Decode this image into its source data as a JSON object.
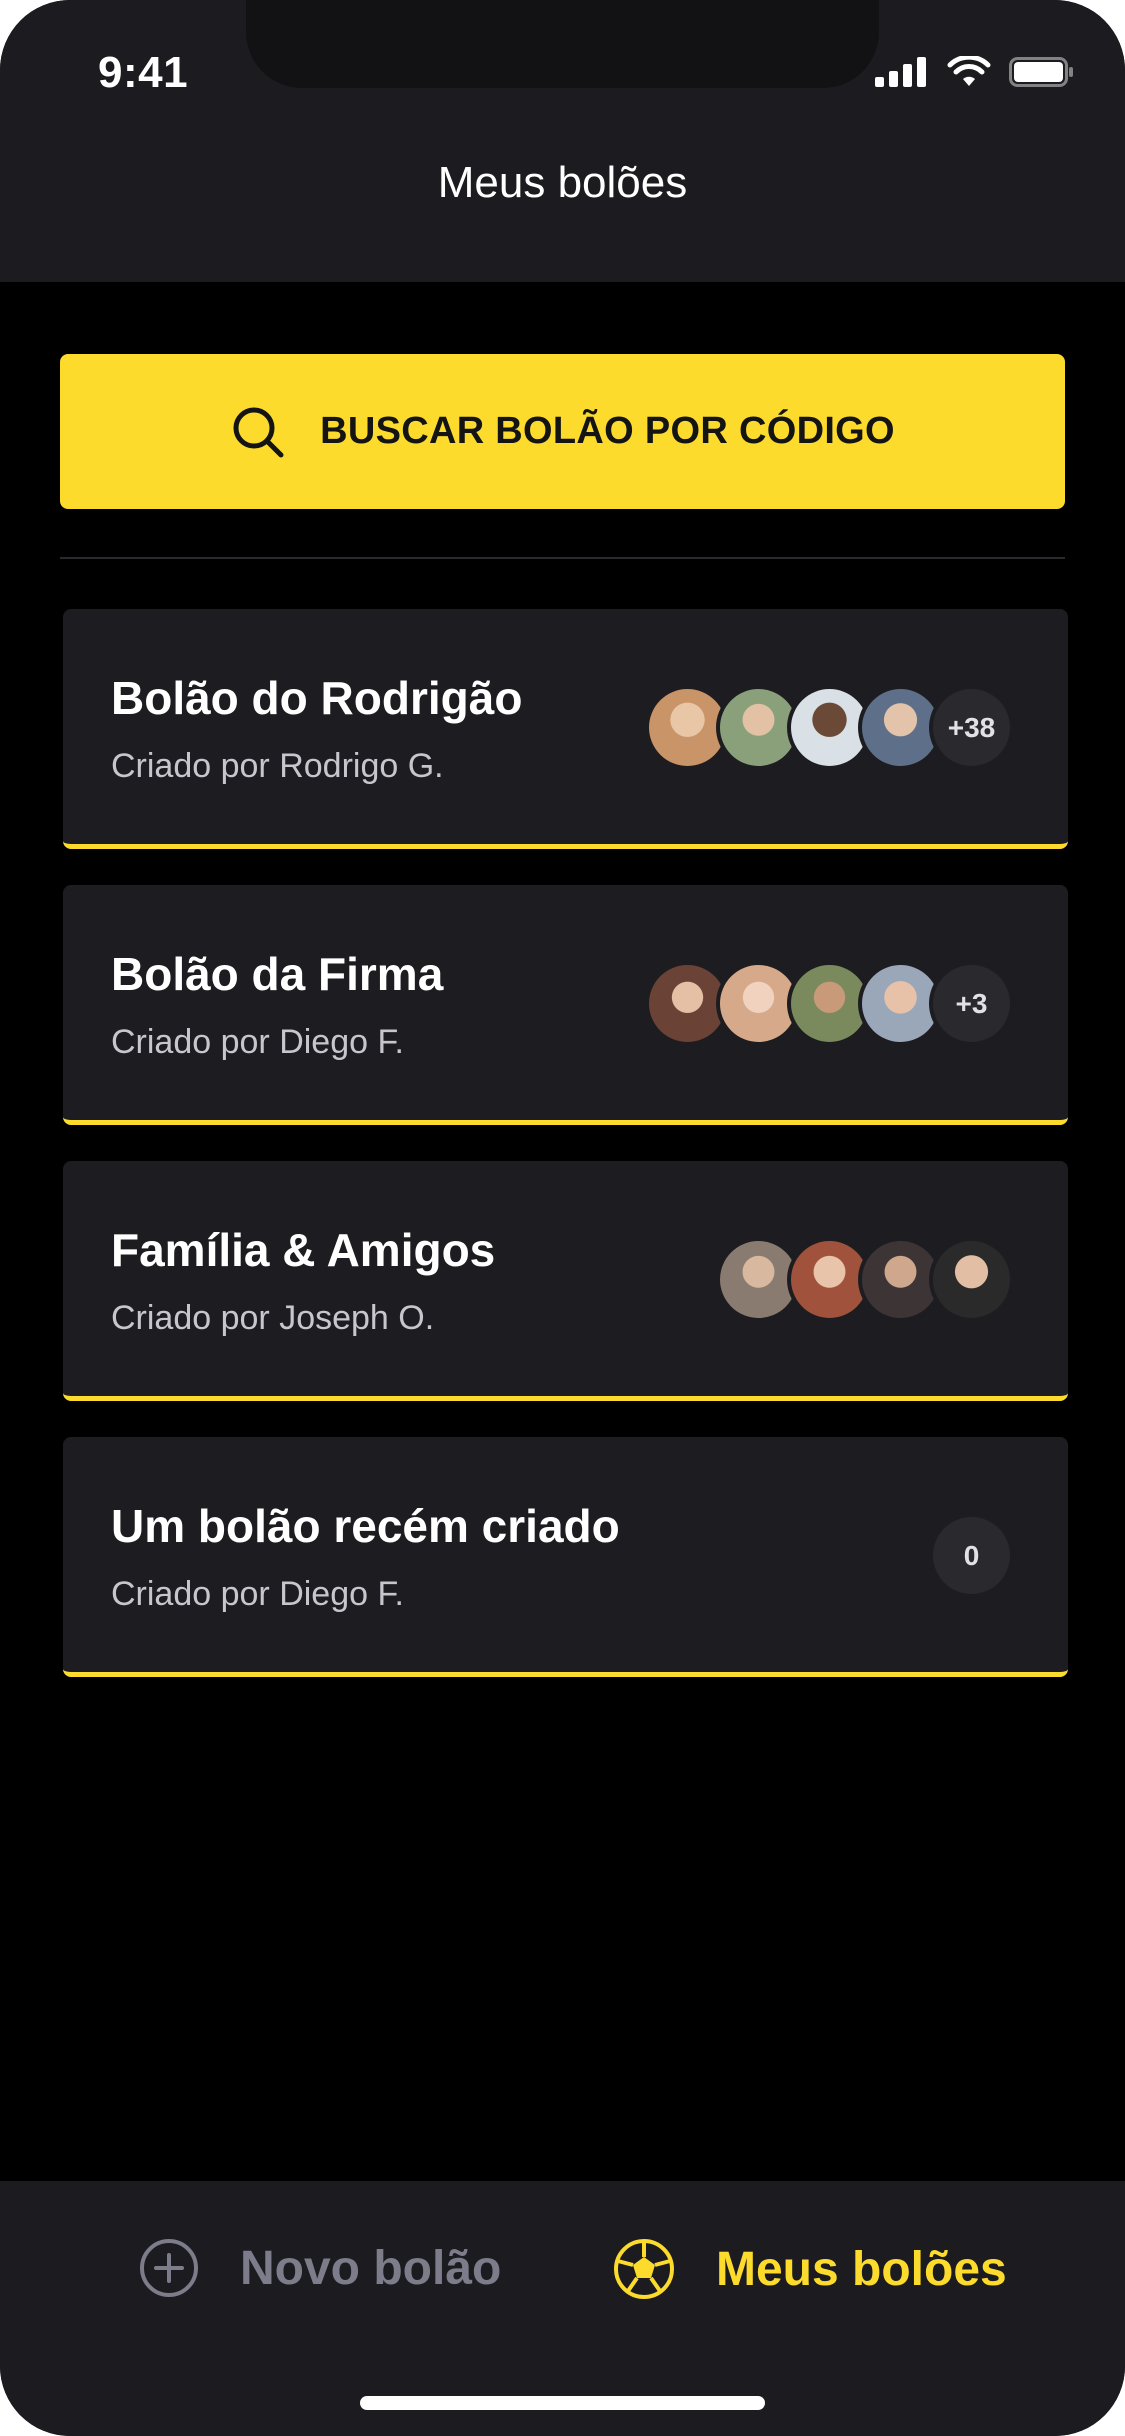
{
  "status_bar": {
    "time": "9:41"
  },
  "header": {
    "title": "Meus bolões"
  },
  "search": {
    "label": "BUSCAR BOLÃO POR CÓDIGO",
    "icon": "search-icon"
  },
  "pools": [
    {
      "title": "Bolão do Rodrigão",
      "creator": "Criado por Rodrigo G.",
      "extra_count": "+38",
      "avatar_colors": [
        "#c99468",
        "#8aa07a",
        "#4c3a2e",
        "#5e6f8a"
      ]
    },
    {
      "title": "Bolão da Firma",
      "creator": "Criado por Diego F.",
      "extra_count": "+3",
      "avatar_colors": [
        "#6b4336",
        "#d6a98a",
        "#7a8a5c",
        "#9aa7b8"
      ]
    },
    {
      "title": "Família & Amigos",
      "creator": "Criado por Joseph O.",
      "extra_count": "",
      "avatar_colors": [
        "#8a7b70",
        "#a0523d",
        "#3d3435",
        "#5a5a5a"
      ]
    },
    {
      "title": "Um bolão recém criado",
      "creator": "Criado por Diego F.",
      "extra_count": "0",
      "avatar_colors": []
    }
  ],
  "tabbar": {
    "new_label": "Novo bolão",
    "mine_label": "Meus bolões",
    "accent": "#fcdb2d",
    "inactive": "#7c7c8a"
  },
  "colors": {
    "accent": "#fcdb2d",
    "background": "#000000",
    "surface": "#1d1d21"
  }
}
